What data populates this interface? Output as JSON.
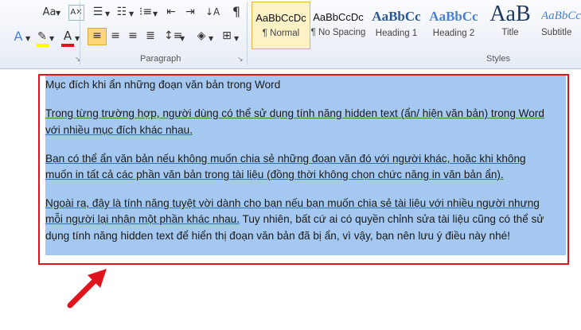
{
  "ribbon": {
    "paragraph_label": "Paragraph",
    "styles_label": "Styles",
    "font_size_case": "Aa",
    "styles": [
      {
        "preview": "AaBbCcDc",
        "name": "¶ Normal"
      },
      {
        "preview": "AaBbCcDc",
        "name": "¶ No Spacing"
      },
      {
        "preview": "AaBbCc",
        "name": "Heading 1"
      },
      {
        "preview": "AaBbCc",
        "name": "Heading 2"
      },
      {
        "preview": "AaB",
        "name": "Title"
      },
      {
        "preview": "AaBbCc",
        "name": "Subtitle"
      }
    ],
    "icons": [
      "clear-formatting-icon",
      "bullets-icon",
      "numbering-icon",
      "multilevel-list-icon",
      "decrease-indent-icon",
      "increase-indent-icon",
      "sort-icon",
      "show-hide-icon",
      "text-effects-icon",
      "highlight-icon",
      "font-color-icon",
      "align-left-icon",
      "center-icon",
      "align-right-icon",
      "justify-icon",
      "line-spacing-icon",
      "shading-icon",
      "borders-icon"
    ]
  },
  "document": {
    "lines": [
      "Mục đích khi ẩn những đoạn văn bản trong Word",
      "Trong từng trường hợp, người dùng có thể sử dụng tính năng hidden text (ẩn/ hiện văn bản) trong Word",
      "với nhiều mục đích khác nhau.",
      "Bạn có thể ẩn văn bản nếu không muốn chia sẻ những đoạn văn đó với người khác, hoặc khi không",
      "muốn in tất cả các phần văn bản trong tài liệu (đồng thời không chọn chức năng in văn bản ẩn).",
      "Ngoài ra, đây là tính năng tuyệt vời dành cho bạn nếu bạn muốn chia sẻ tài liệu với nhiều người nhưng",
      "mỗi người lại nhận một phần khác nhau.",
      " Tuy nhiên, bất cứ ai có quyền chỉnh sửa tài liệu cũng có thể sử",
      "dụng tính năng hidden text để hiển thị đoạn văn bản đã bị ẩn, vì vậy, bạn nên lưu ý điều này nhé!"
    ]
  },
  "annotation": {
    "highlight_color": "#e0141e",
    "selection_color": "#a4c8ef"
  }
}
